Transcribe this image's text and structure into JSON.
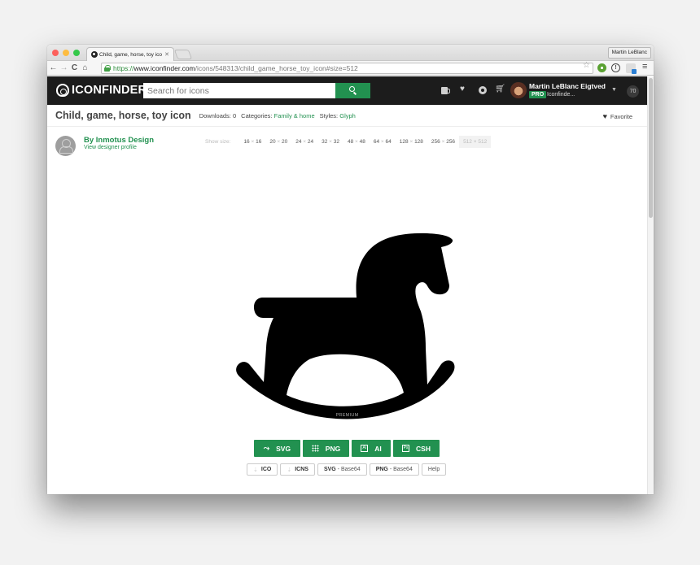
{
  "browser": {
    "tab_title": "Child, game, horse, toy ico",
    "profile_name": "Martin LeBlanc",
    "url": {
      "scheme": "https://",
      "host": "www.iconfinder.com",
      "path": "/icons/548313/child_game_horse_toy_icon#size=512"
    }
  },
  "header": {
    "logo_text": "ICONFINDER",
    "search_placeholder": "Search for icons",
    "user_name": "Martin LeBlanc Eigtved",
    "pro_badge": "PRO",
    "user_org": "Iconfinde...",
    "notification_count": "70"
  },
  "icon": {
    "title": "Child, game, horse, toy icon",
    "downloads_label": "Downloads: 0",
    "categories_label": "Categories:",
    "category": "Family & home",
    "styles_label": "Styles:",
    "style": "Glyph",
    "favorite_label": "Favorite",
    "premium_label": "PREMIUM"
  },
  "designer": {
    "name": "By Inmotus Design",
    "profile_link": "View designer profile"
  },
  "sizes": {
    "label": "Show size:",
    "options": [
      {
        "a": "16",
        "b": "16"
      },
      {
        "a": "20",
        "b": "20"
      },
      {
        "a": "24",
        "b": "24"
      },
      {
        "a": "32",
        "b": "32"
      },
      {
        "a": "48",
        "b": "48"
      },
      {
        "a": "64",
        "b": "64"
      },
      {
        "a": "128",
        "b": "128"
      },
      {
        "a": "256",
        "b": "256"
      },
      {
        "a": "512",
        "b": "512"
      }
    ],
    "selected": "512"
  },
  "downloads": {
    "primary": [
      "SVG",
      "PNG",
      "AI",
      "CSH"
    ],
    "secondary": [
      {
        "bold": "ICO",
        "rest": ""
      },
      {
        "bold": "ICNS",
        "rest": ""
      },
      {
        "bold": "SVG",
        "rest": " - Base64"
      },
      {
        "bold": "PNG",
        "rest": " - Base64"
      },
      {
        "bold": "",
        "rest": "Help"
      }
    ]
  },
  "colors": {
    "brand_green": "#229150",
    "header_bg": "#1c1c1c"
  }
}
